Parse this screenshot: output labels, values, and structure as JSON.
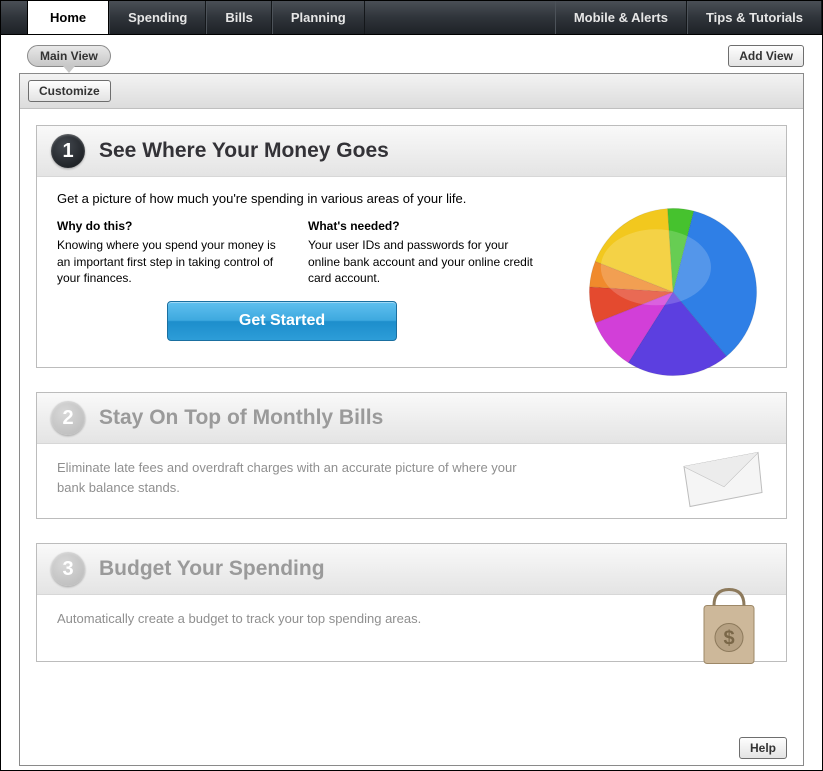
{
  "nav": {
    "tabs": [
      "Home",
      "Spending",
      "Bills",
      "Planning"
    ],
    "right_tabs": [
      "Mobile & Alerts",
      "Tips & Tutorials"
    ],
    "active": "Home"
  },
  "subbar": {
    "main_view": "Main View",
    "add_view": "Add View"
  },
  "toolbar": {
    "customize": "Customize"
  },
  "cards": [
    {
      "num": "1",
      "title": "See Where Your Money Goes",
      "intro": "Get a picture of how much you're spending in various areas of your life.",
      "why_q": "Why do this?",
      "why_a": "Knowing where you spend your money is an important first step in taking control of your finances.",
      "what_q": "What's needed?",
      "what_a": "Your user IDs and passwords for your online bank account and your online credit card account.",
      "cta": "Get Started"
    },
    {
      "num": "2",
      "title": "Stay On Top of Monthly Bills",
      "desc": "Eliminate late fees and overdraft charges with an accurate picture of where your bank balance stands."
    },
    {
      "num": "3",
      "title": "Budget Your Spending",
      "desc": "Automatically create a budget to track your top spending areas."
    }
  ],
  "footer": {
    "help": "Help"
  },
  "chart_data": {
    "type": "pie",
    "title": "",
    "series": [
      {
        "name": "Blue",
        "value": 35,
        "color": "#2f7fe6"
      },
      {
        "name": "Indigo",
        "value": 20,
        "color": "#5c3fe0"
      },
      {
        "name": "Magenta",
        "value": 10,
        "color": "#d23fd8"
      },
      {
        "name": "Red",
        "value": 7,
        "color": "#e44a2f"
      },
      {
        "name": "Orange",
        "value": 5,
        "color": "#f08a2c"
      },
      {
        "name": "Yellow",
        "value": 18,
        "color": "#f2c81e"
      },
      {
        "name": "Green",
        "value": 5,
        "color": "#46c22e"
      }
    ]
  }
}
